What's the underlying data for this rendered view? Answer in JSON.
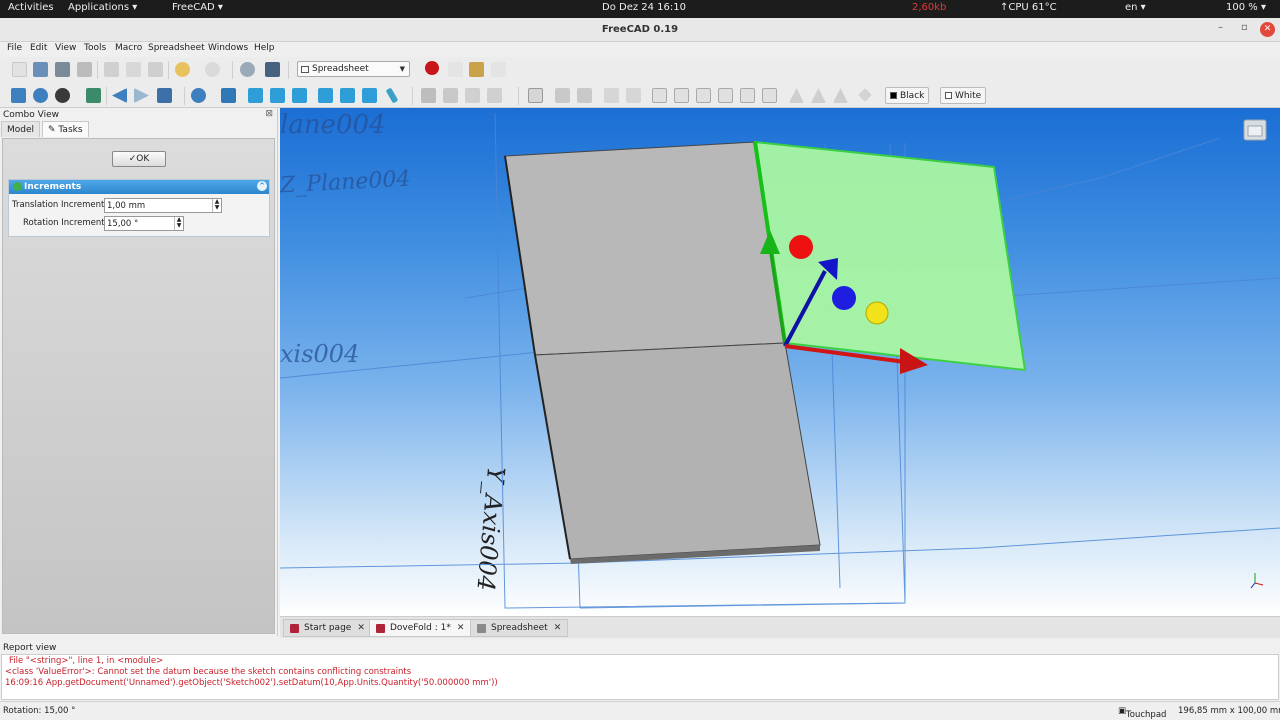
{
  "topbar": {
    "activities": "Activities",
    "applications": "Applications ▾",
    "app": "FreeCAD ▾",
    "datetime": "Do Dez 24  16:10",
    "net": "2,60kb",
    "cpu": "↑CPU 61°C",
    "lang": "en ▾",
    "battery": "100 % ▾"
  },
  "window": {
    "title": "FreeCAD 0.19"
  },
  "menu": [
    "File",
    "Edit",
    "View",
    "Tools",
    "Macro",
    "Spreadsheet",
    "Windows",
    "Help"
  ],
  "toolbar": {
    "workbench": "Spreadsheet",
    "black_label": "Black",
    "white_label": "White"
  },
  "combo": {
    "title": "Combo View",
    "tab_model": "Model",
    "tab_tasks": "Tasks",
    "ok_label": "OK",
    "increments_title": "Increments",
    "translation_label": "Translation Increment:",
    "translation_value": "1,00 mm",
    "rotation_label": "Rotation Increment:",
    "rotation_value": "15,00 °"
  },
  "viewport": {
    "label_plane": "lane004",
    "label_zplane": "Z_Plane004",
    "label_axis": "xis004",
    "label_yaxis": "Y_Axis004"
  },
  "doc_tabs": [
    "Start page",
    "DoveFold : 1*",
    "Spreadsheet"
  ],
  "report": {
    "title": "Report view",
    "lines": [
      "File \"<string>\", line 1, in <module>",
      "<class 'ValueError'>: Cannot set the datum because the sketch contains conflicting constraints",
      "16:09:16  App.getDocument('Unnamed').getObject('Sketch002').setDatum(10,App.Units.Quantity('50.000000 mm'))"
    ]
  },
  "status": {
    "left": "Rotation: 15,00 °",
    "nav": "Touchpad",
    "dims": "196,85 mm x 100,00 mm"
  },
  "colors": {
    "face_selected": "#a9f7a3",
    "face_gray": "#b4b4b4",
    "record": "#c8141a"
  }
}
